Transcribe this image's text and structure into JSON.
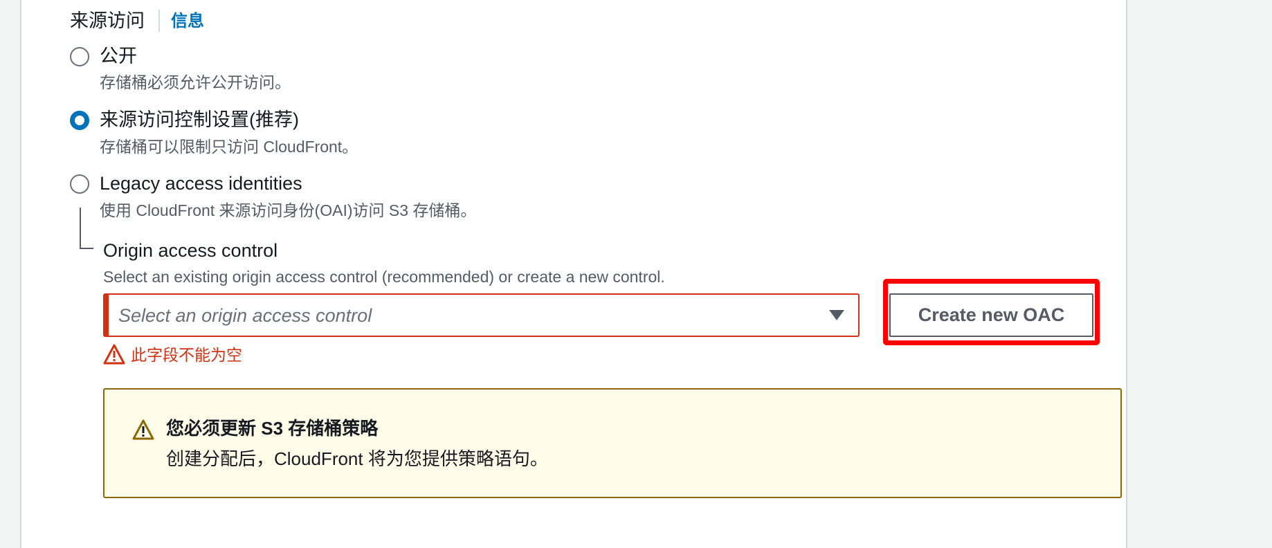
{
  "origin_access": {
    "label": "来源访问",
    "info_link": "信息",
    "options": [
      {
        "title": "公开",
        "description": "存储桶必须允许公开访问。",
        "selected": false
      },
      {
        "title": "来源访问控制设置(推荐)",
        "description": "存储桶可以限制只访问 CloudFront。",
        "selected": true
      },
      {
        "title": "Legacy access identities",
        "description": "使用 CloudFront 来源访问身份(OAI)访问 S3 存储桶。",
        "selected": false
      }
    ]
  },
  "oac_field": {
    "title": "Origin access control",
    "description": "Select an existing origin access control (recommended) or create a new control.",
    "select_placeholder": "Select an origin access control",
    "error_text": "此字段不能为空",
    "create_button_label": "Create new OAC"
  },
  "alert": {
    "title": "您必须更新 S3 存储桶策略",
    "body": "创建分配后，CloudFront 将为您提供策略语句。"
  },
  "colors": {
    "accent": "#0073bb",
    "error": "#d13212",
    "warning_border": "#8d6605",
    "warning_bg": "#fffce9",
    "highlight": "#ff0000"
  }
}
